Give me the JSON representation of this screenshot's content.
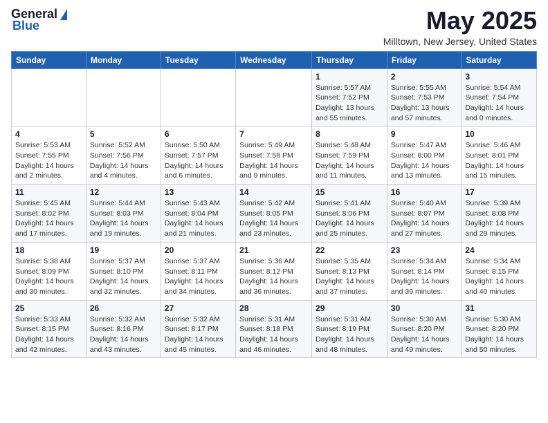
{
  "header": {
    "logo_general": "General",
    "logo_blue": "Blue",
    "month_title": "May 2025",
    "location": "Milltown, New Jersey, United States"
  },
  "weekdays": [
    "Sunday",
    "Monday",
    "Tuesday",
    "Wednesday",
    "Thursday",
    "Friday",
    "Saturday"
  ],
  "weeks": [
    [
      {
        "day": "",
        "info": ""
      },
      {
        "day": "",
        "info": ""
      },
      {
        "day": "",
        "info": ""
      },
      {
        "day": "",
        "info": ""
      },
      {
        "day": "1",
        "info": "Sunrise: 5:57 AM\nSunset: 7:52 PM\nDaylight: 13 hours\nand 55 minutes."
      },
      {
        "day": "2",
        "info": "Sunrise: 5:55 AM\nSunset: 7:53 PM\nDaylight: 13 hours\nand 57 minutes."
      },
      {
        "day": "3",
        "info": "Sunrise: 5:54 AM\nSunset: 7:54 PM\nDaylight: 14 hours\nand 0 minutes."
      }
    ],
    [
      {
        "day": "4",
        "info": "Sunrise: 5:53 AM\nSunset: 7:55 PM\nDaylight: 14 hours\nand 2 minutes."
      },
      {
        "day": "5",
        "info": "Sunrise: 5:52 AM\nSunset: 7:56 PM\nDaylight: 14 hours\nand 4 minutes."
      },
      {
        "day": "6",
        "info": "Sunrise: 5:50 AM\nSunset: 7:57 PM\nDaylight: 14 hours\nand 6 minutes."
      },
      {
        "day": "7",
        "info": "Sunrise: 5:49 AM\nSunset: 7:58 PM\nDaylight: 14 hours\nand 9 minutes."
      },
      {
        "day": "8",
        "info": "Sunrise: 5:48 AM\nSunset: 7:59 PM\nDaylight: 14 hours\nand 11 minutes."
      },
      {
        "day": "9",
        "info": "Sunrise: 5:47 AM\nSunset: 8:00 PM\nDaylight: 14 hours\nand 13 minutes."
      },
      {
        "day": "10",
        "info": "Sunrise: 5:46 AM\nSunset: 8:01 PM\nDaylight: 14 hours\nand 15 minutes."
      }
    ],
    [
      {
        "day": "11",
        "info": "Sunrise: 5:45 AM\nSunset: 8:02 PM\nDaylight: 14 hours\nand 17 minutes."
      },
      {
        "day": "12",
        "info": "Sunrise: 5:44 AM\nSunset: 8:03 PM\nDaylight: 14 hours\nand 19 minutes."
      },
      {
        "day": "13",
        "info": "Sunrise: 5:43 AM\nSunset: 8:04 PM\nDaylight: 14 hours\nand 21 minutes."
      },
      {
        "day": "14",
        "info": "Sunrise: 5:42 AM\nSunset: 8:05 PM\nDaylight: 14 hours\nand 23 minutes."
      },
      {
        "day": "15",
        "info": "Sunrise: 5:41 AM\nSunset: 8:06 PM\nDaylight: 14 hours\nand 25 minutes."
      },
      {
        "day": "16",
        "info": "Sunrise: 5:40 AM\nSunset: 8:07 PM\nDaylight: 14 hours\nand 27 minutes."
      },
      {
        "day": "17",
        "info": "Sunrise: 5:39 AM\nSunset: 8:08 PM\nDaylight: 14 hours\nand 29 minutes."
      }
    ],
    [
      {
        "day": "18",
        "info": "Sunrise: 5:38 AM\nSunset: 8:09 PM\nDaylight: 14 hours\nand 30 minutes."
      },
      {
        "day": "19",
        "info": "Sunrise: 5:37 AM\nSunset: 8:10 PM\nDaylight: 14 hours\nand 32 minutes."
      },
      {
        "day": "20",
        "info": "Sunrise: 5:37 AM\nSunset: 8:11 PM\nDaylight: 14 hours\nand 34 minutes."
      },
      {
        "day": "21",
        "info": "Sunrise: 5:36 AM\nSunset: 8:12 PM\nDaylight: 14 hours\nand 36 minutes."
      },
      {
        "day": "22",
        "info": "Sunrise: 5:35 AM\nSunset: 8:13 PM\nDaylight: 14 hours\nand 37 minutes."
      },
      {
        "day": "23",
        "info": "Sunrise: 5:34 AM\nSunset: 8:14 PM\nDaylight: 14 hours\nand 39 minutes."
      },
      {
        "day": "24",
        "info": "Sunrise: 5:34 AM\nSunset: 8:15 PM\nDaylight: 14 hours\nand 40 minutes."
      }
    ],
    [
      {
        "day": "25",
        "info": "Sunrise: 5:33 AM\nSunset: 8:15 PM\nDaylight: 14 hours\nand 42 minutes."
      },
      {
        "day": "26",
        "info": "Sunrise: 5:32 AM\nSunset: 8:16 PM\nDaylight: 14 hours\nand 43 minutes."
      },
      {
        "day": "27",
        "info": "Sunrise: 5:32 AM\nSunset: 8:17 PM\nDaylight: 14 hours\nand 45 minutes."
      },
      {
        "day": "28",
        "info": "Sunrise: 5:31 AM\nSunset: 8:18 PM\nDaylight: 14 hours\nand 46 minutes."
      },
      {
        "day": "29",
        "info": "Sunrise: 5:31 AM\nSunset: 8:19 PM\nDaylight: 14 hours\nand 48 minutes."
      },
      {
        "day": "30",
        "info": "Sunrise: 5:30 AM\nSunset: 8:20 PM\nDaylight: 14 hours\nand 49 minutes."
      },
      {
        "day": "31",
        "info": "Sunrise: 5:30 AM\nSunset: 8:20 PM\nDaylight: 14 hours\nand 50 minutes."
      }
    ]
  ]
}
